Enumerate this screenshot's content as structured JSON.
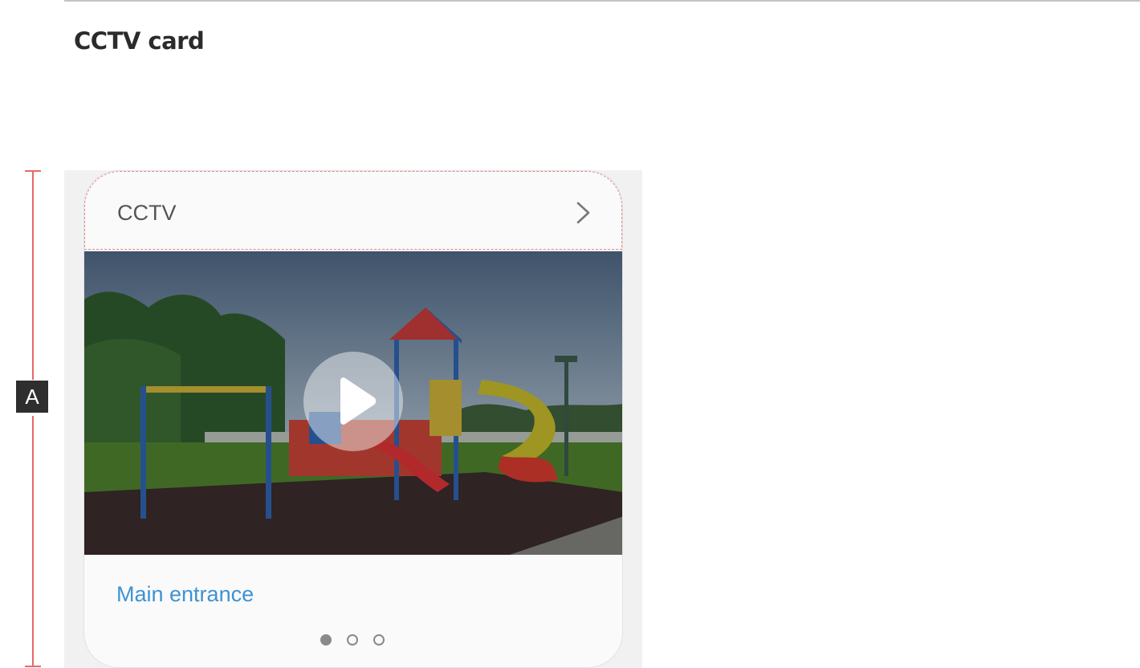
{
  "page": {
    "title": "CCTV card"
  },
  "spec": {
    "marker": "A"
  },
  "card": {
    "title": "CCTV",
    "chevron_icon": "chevron-right-icon",
    "video": {
      "play_icon": "play-icon"
    },
    "location": "Main entrance",
    "pager": {
      "count": 3,
      "active_index": 0
    }
  },
  "colors": {
    "title_text": "#2b2b2b",
    "card_title_text": "#555555",
    "location_text": "#3e93d2",
    "spec_line": "#e46a6a",
    "spec_badge": "#2e2e2e"
  }
}
